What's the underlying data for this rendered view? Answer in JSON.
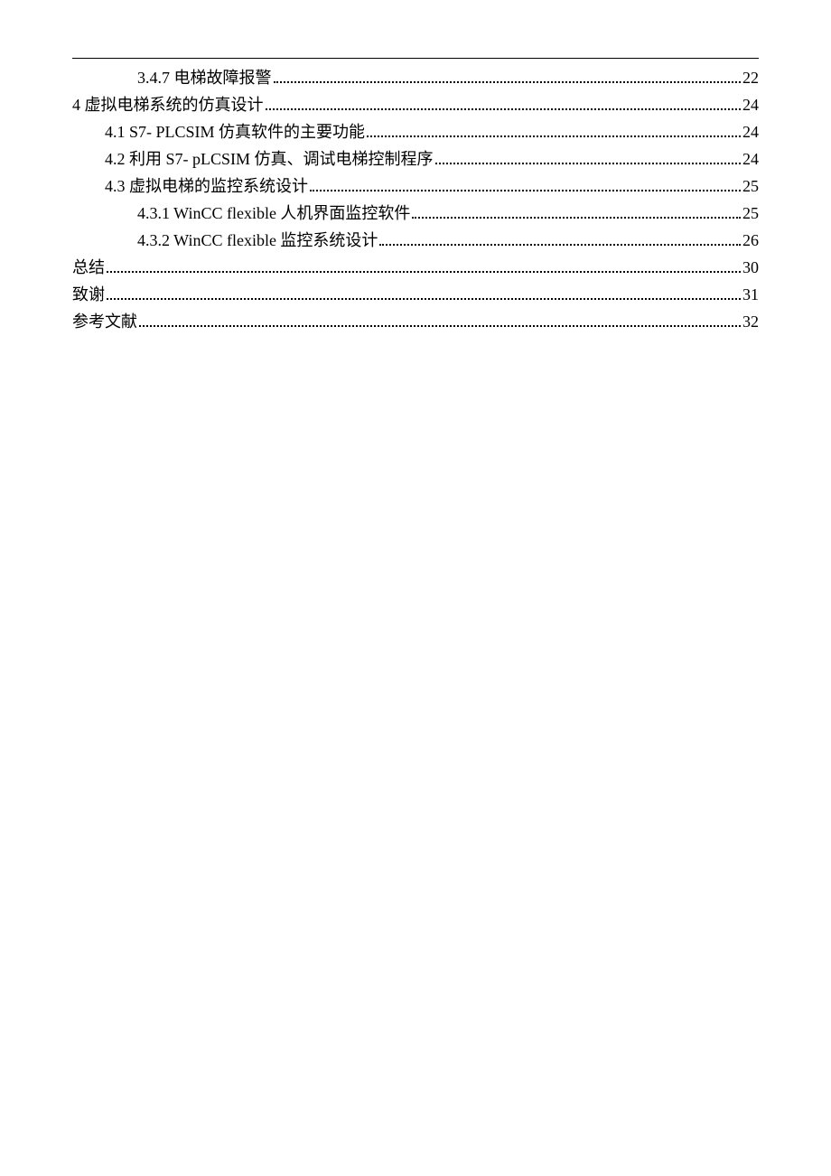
{
  "toc": [
    {
      "indent": 2,
      "title": "3.4.7 电梯故障报警",
      "page": "22"
    },
    {
      "indent": 0,
      "title": "4  虚拟电梯系统的仿真设计",
      "page": "24"
    },
    {
      "indent": 1,
      "title": "4.1 S7- PLCSIM 仿真软件的主要功能",
      "page": "24"
    },
    {
      "indent": 1,
      "title": "4.2 利用 S7- pLCSIM 仿真、调试电梯控制程序",
      "page": "24"
    },
    {
      "indent": 1,
      "title": "4.3 虚拟电梯的监控系统设计",
      "page": "25"
    },
    {
      "indent": 2,
      "title": "4.3.1 WinCC flexible 人机界面监控软件",
      "page": "25"
    },
    {
      "indent": 2,
      "title": "4.3.2 WinCC flexible 监控系统设计",
      "page": "26"
    },
    {
      "indent": 0,
      "title": "总结",
      "page": "30"
    },
    {
      "indent": 0,
      "title": "致谢",
      "page": "31"
    },
    {
      "indent": 0,
      "title": "参考文献",
      "page": "32"
    }
  ]
}
